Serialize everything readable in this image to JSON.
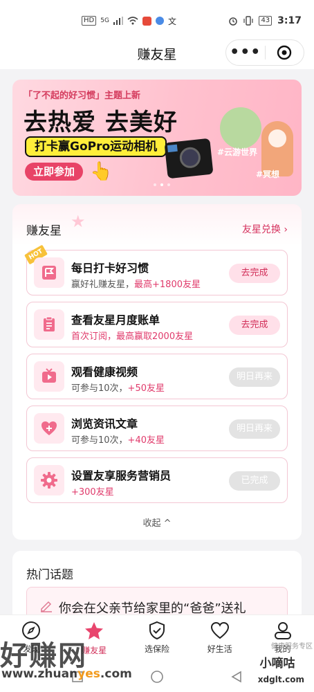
{
  "status": {
    "time": "3:17",
    "battery": "43",
    "hd": "HD",
    "signal": "5G"
  },
  "header": {
    "title": "赚友星"
  },
  "banner": {
    "tag": "「了不起的好习惯」主题上新",
    "title": "去热爱 去美好",
    "subtitle": "打卡赢GoPro运动相机",
    "cta": "立即参加",
    "tag_cloud": "#云游世界",
    "tag_relax": "#冥想"
  },
  "card": {
    "title": "赚友星",
    "link": "友星兑换 ›",
    "collapse": "收起 ^",
    "tasks": [
      {
        "hot": "HOT",
        "title": "每日打卡好习惯",
        "desc": "赢好礼赚友星，",
        "desc_hl": "最高+1800友星",
        "button": "去完成",
        "icon": "flag-icon"
      },
      {
        "title": "查看友星月度账单",
        "desc": "",
        "desc_hl": "首次订阅，最高赢取2000友星",
        "button": "去完成",
        "icon": "clipboard-icon"
      },
      {
        "title": "观看健康视频",
        "desc": "可参与10次，",
        "desc_hl": "+50友星",
        "button": "明日再来",
        "icon": "tv-icon"
      },
      {
        "title": "浏览资讯文章",
        "desc": "可参与10次，",
        "desc_hl": "+40友星",
        "button": "明日再来",
        "icon": "heart-plus-icon"
      },
      {
        "title": "设置友享服务营销员",
        "desc": "",
        "desc_hl": "+300友星",
        "button": "已完成",
        "icon": "gear-icon"
      }
    ]
  },
  "topics": {
    "title": "热门话题",
    "first": "你会在父亲节给家里的“爸爸”送礼"
  },
  "tabs": [
    {
      "label": "发现",
      "icon": "compass-icon"
    },
    {
      "label": "赚友星",
      "icon": "star-icon"
    },
    {
      "label": "选保险",
      "icon": "shield-icon"
    },
    {
      "label": "好生活",
      "icon": "heart-icon"
    },
    {
      "label": "我的",
      "icon": "user-icon"
    }
  ],
  "watermark": {
    "brand": "好赚网",
    "url_a": "www.zhuan",
    "url_b": "yes",
    "url_c": ".com",
    "badge": "小嘀咕",
    "badge_url": "xdglt.com",
    "faded": "健康服务专区"
  },
  "colors": {
    "accent": "#d12e58",
    "banner_bg": "#ffc1ce",
    "button_go_bg": "#ffe0e9",
    "button_off_bg": "#e3e3e3"
  }
}
